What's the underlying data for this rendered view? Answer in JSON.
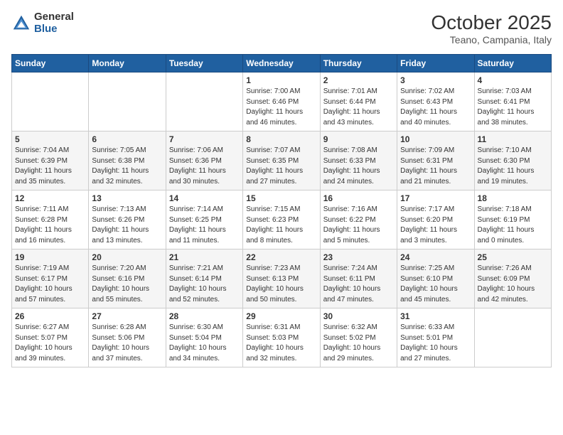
{
  "header": {
    "logo_general": "General",
    "logo_blue": "Blue",
    "month": "October 2025",
    "location": "Teano, Campania, Italy"
  },
  "weekdays": [
    "Sunday",
    "Monday",
    "Tuesday",
    "Wednesday",
    "Thursday",
    "Friday",
    "Saturday"
  ],
  "weeks": [
    [
      {
        "day": "",
        "info": ""
      },
      {
        "day": "",
        "info": ""
      },
      {
        "day": "",
        "info": ""
      },
      {
        "day": "1",
        "info": "Sunrise: 7:00 AM\nSunset: 6:46 PM\nDaylight: 11 hours\nand 46 minutes."
      },
      {
        "day": "2",
        "info": "Sunrise: 7:01 AM\nSunset: 6:44 PM\nDaylight: 11 hours\nand 43 minutes."
      },
      {
        "day": "3",
        "info": "Sunrise: 7:02 AM\nSunset: 6:43 PM\nDaylight: 11 hours\nand 40 minutes."
      },
      {
        "day": "4",
        "info": "Sunrise: 7:03 AM\nSunset: 6:41 PM\nDaylight: 11 hours\nand 38 minutes."
      }
    ],
    [
      {
        "day": "5",
        "info": "Sunrise: 7:04 AM\nSunset: 6:39 PM\nDaylight: 11 hours\nand 35 minutes."
      },
      {
        "day": "6",
        "info": "Sunrise: 7:05 AM\nSunset: 6:38 PM\nDaylight: 11 hours\nand 32 minutes."
      },
      {
        "day": "7",
        "info": "Sunrise: 7:06 AM\nSunset: 6:36 PM\nDaylight: 11 hours\nand 30 minutes."
      },
      {
        "day": "8",
        "info": "Sunrise: 7:07 AM\nSunset: 6:35 PM\nDaylight: 11 hours\nand 27 minutes."
      },
      {
        "day": "9",
        "info": "Sunrise: 7:08 AM\nSunset: 6:33 PM\nDaylight: 11 hours\nand 24 minutes."
      },
      {
        "day": "10",
        "info": "Sunrise: 7:09 AM\nSunset: 6:31 PM\nDaylight: 11 hours\nand 21 minutes."
      },
      {
        "day": "11",
        "info": "Sunrise: 7:10 AM\nSunset: 6:30 PM\nDaylight: 11 hours\nand 19 minutes."
      }
    ],
    [
      {
        "day": "12",
        "info": "Sunrise: 7:11 AM\nSunset: 6:28 PM\nDaylight: 11 hours\nand 16 minutes."
      },
      {
        "day": "13",
        "info": "Sunrise: 7:13 AM\nSunset: 6:26 PM\nDaylight: 11 hours\nand 13 minutes."
      },
      {
        "day": "14",
        "info": "Sunrise: 7:14 AM\nSunset: 6:25 PM\nDaylight: 11 hours\nand 11 minutes."
      },
      {
        "day": "15",
        "info": "Sunrise: 7:15 AM\nSunset: 6:23 PM\nDaylight: 11 hours\nand 8 minutes."
      },
      {
        "day": "16",
        "info": "Sunrise: 7:16 AM\nSunset: 6:22 PM\nDaylight: 11 hours\nand 5 minutes."
      },
      {
        "day": "17",
        "info": "Sunrise: 7:17 AM\nSunset: 6:20 PM\nDaylight: 11 hours\nand 3 minutes."
      },
      {
        "day": "18",
        "info": "Sunrise: 7:18 AM\nSunset: 6:19 PM\nDaylight: 11 hours\nand 0 minutes."
      }
    ],
    [
      {
        "day": "19",
        "info": "Sunrise: 7:19 AM\nSunset: 6:17 PM\nDaylight: 10 hours\nand 57 minutes."
      },
      {
        "day": "20",
        "info": "Sunrise: 7:20 AM\nSunset: 6:16 PM\nDaylight: 10 hours\nand 55 minutes."
      },
      {
        "day": "21",
        "info": "Sunrise: 7:21 AM\nSunset: 6:14 PM\nDaylight: 10 hours\nand 52 minutes."
      },
      {
        "day": "22",
        "info": "Sunrise: 7:23 AM\nSunset: 6:13 PM\nDaylight: 10 hours\nand 50 minutes."
      },
      {
        "day": "23",
        "info": "Sunrise: 7:24 AM\nSunset: 6:11 PM\nDaylight: 10 hours\nand 47 minutes."
      },
      {
        "day": "24",
        "info": "Sunrise: 7:25 AM\nSunset: 6:10 PM\nDaylight: 10 hours\nand 45 minutes."
      },
      {
        "day": "25",
        "info": "Sunrise: 7:26 AM\nSunset: 6:09 PM\nDaylight: 10 hours\nand 42 minutes."
      }
    ],
    [
      {
        "day": "26",
        "info": "Sunrise: 6:27 AM\nSunset: 5:07 PM\nDaylight: 10 hours\nand 39 minutes."
      },
      {
        "day": "27",
        "info": "Sunrise: 6:28 AM\nSunset: 5:06 PM\nDaylight: 10 hours\nand 37 minutes."
      },
      {
        "day": "28",
        "info": "Sunrise: 6:30 AM\nSunset: 5:04 PM\nDaylight: 10 hours\nand 34 minutes."
      },
      {
        "day": "29",
        "info": "Sunrise: 6:31 AM\nSunset: 5:03 PM\nDaylight: 10 hours\nand 32 minutes."
      },
      {
        "day": "30",
        "info": "Sunrise: 6:32 AM\nSunset: 5:02 PM\nDaylight: 10 hours\nand 29 minutes."
      },
      {
        "day": "31",
        "info": "Sunrise: 6:33 AM\nSunset: 5:01 PM\nDaylight: 10 hours\nand 27 minutes."
      },
      {
        "day": "",
        "info": ""
      }
    ]
  ]
}
